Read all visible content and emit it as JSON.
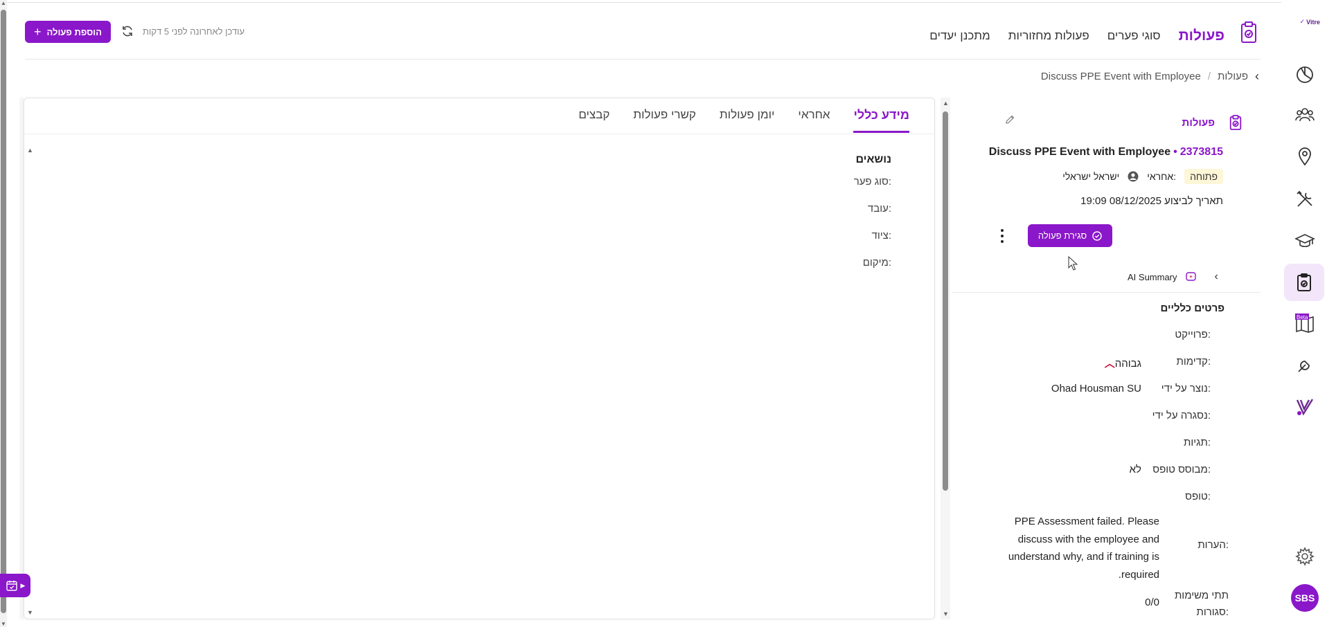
{
  "brand": {
    "name": "Vitre",
    "accent": "#8a17c9"
  },
  "header": {
    "title": "פעולות",
    "nav": [
      "פעולות",
      "סוגי פערים",
      "פעולות מחזוריות",
      "מתכנן יעדים"
    ],
    "updated_text": "עודכן לאחרונה לפני 5 דקות",
    "add_button_label": "הוספת פעולה"
  },
  "breadcrumb": {
    "root": "פעולות",
    "current": "Discuss PPE Event with Employee"
  },
  "tabs": [
    "מידע כללי",
    "אחראי",
    "יומן פעולות",
    "קשרי פעולות",
    "קבצים"
  ],
  "topics": {
    "heading": "נושאים",
    "rows": [
      "סוג פער:",
      "עובד:",
      "ציוד:",
      "מיקום:"
    ]
  },
  "item": {
    "category": "פעולות",
    "id": "2373815",
    "title": "Discuss PPE Event with Employee",
    "status": "פתוחה",
    "owner_label": "אחראי:",
    "owner_name": "ישראל ישראלי",
    "due_label": "תאריך לביצוע",
    "due_value": "08/12/2025 19:09",
    "close_button_label": "סגירת פעולה",
    "ai_label": "AI Summary"
  },
  "details": {
    "heading": "פרטים כלליים",
    "rows": [
      {
        "k": "פרוייקט:",
        "v": ""
      },
      {
        "k": "קדימות:",
        "v": "גבוהה"
      },
      {
        "k": "נוצר על ידי:",
        "v": "Ohad Housman SU"
      },
      {
        "k": "נסגרה על ידי:",
        "v": ""
      },
      {
        "k": "תגיות:",
        "v": ""
      },
      {
        "k": "מבוסס טופס:",
        "v": "לא"
      },
      {
        "k": "טופס:",
        "v": ""
      }
    ],
    "notes_label": "הערות:",
    "notes_lines": [
      "PPE Assessment failed. Please",
      "discuss with the employee and",
      "understand why, and if training is",
      ".required"
    ],
    "subtasks_label_1": "תתי משימות",
    "subtasks_label_2": "סגורות:",
    "subtasks_value": "0/0"
  },
  "user": {
    "initials": "SBS"
  },
  "icons": [
    "chart-icon",
    "team-icon",
    "location-icon",
    "tools-icon",
    "training-icon",
    "actions-icon",
    "map-icon",
    "wrench-icon",
    "vitre-v-icon",
    "settings-icon"
  ]
}
